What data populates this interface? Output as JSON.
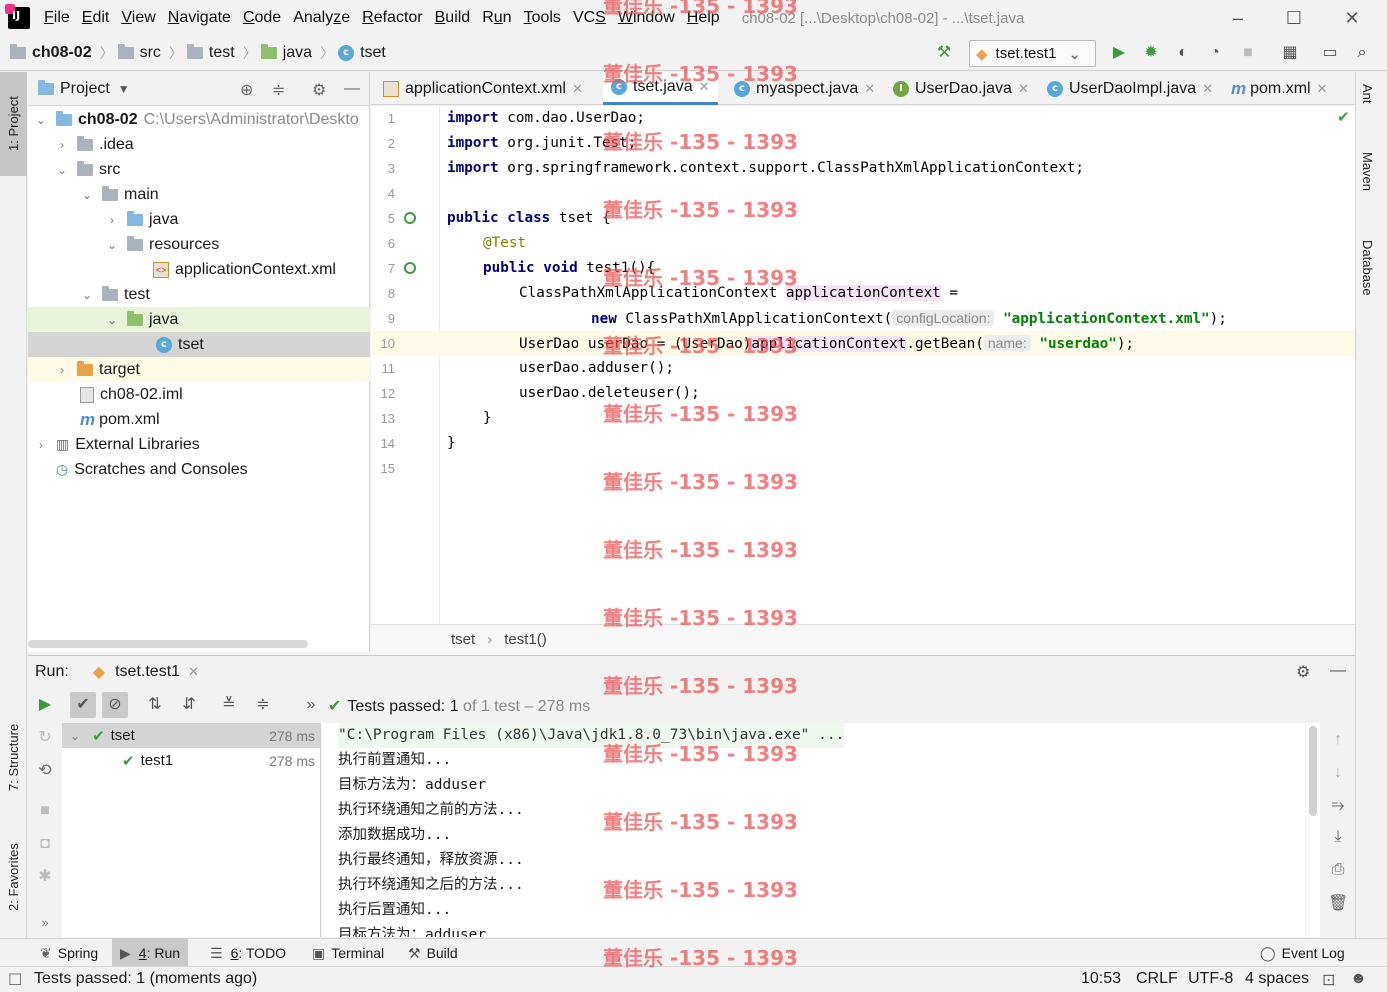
{
  "menu": {
    "items": [
      "File",
      "Edit",
      "View",
      "Navigate",
      "Code",
      "Analyze",
      "Refactor",
      "Build",
      "Run",
      "Tools",
      "VCS",
      "Window",
      "Help"
    ],
    "mnemonics": [
      "F",
      "E",
      "V",
      "N",
      "C",
      "z",
      "R",
      "B",
      "u",
      "T",
      "S",
      "W",
      "H"
    ],
    "window_title": "ch08-02 [...\\Desktop\\ch08-02] - ...\\tset.java"
  },
  "navbar": {
    "crumbs": [
      "ch08-02",
      "src",
      "test",
      "java",
      "tset"
    ],
    "run_config": "tset.test1"
  },
  "left_stripe": {
    "project": "1: Project",
    "structure": "7: Structure",
    "favorites": "2: Favorites"
  },
  "right_stripe": {
    "ant": "Ant",
    "maven": "Maven",
    "database": "Database"
  },
  "project": {
    "title": "Project",
    "root_name": "ch08-02",
    "root_path": "C:\\Users\\Administrator\\Deskto",
    "nodes": [
      ".idea",
      "src",
      "main",
      "java",
      "resources",
      "applicationContext.xml",
      "test",
      "java",
      "tset",
      "target",
      "ch08-02.iml",
      "pom.xml",
      "External Libraries",
      "Scratches and Consoles"
    ]
  },
  "editor": {
    "tabs": [
      "applicationContext.xml",
      "tset.java",
      "myaspect.java",
      "UserDao.java",
      "UserDaoImpl.java",
      "pom.xml"
    ],
    "active_tab": "tset.java",
    "line_numbers": [
      "1",
      "2",
      "3",
      "4",
      "5",
      "6",
      "7",
      "8",
      "9",
      "10",
      "11",
      "12",
      "13",
      "14",
      "15"
    ],
    "code": {
      "l1_kw": "import",
      "l1_rest": " com.dao.UserDao;",
      "l2_kw": "import",
      "l2_rest": " org.junit.Test;",
      "l3_kw": "import",
      "l3_rest": " org.springframework.context.support.ClassPathXmlApplicationContext;",
      "l5_kw": "public class",
      "l5_rest": " tset {",
      "l6_ann": "@Test",
      "l7_kw": "public void",
      "l7_rest": " test1(){",
      "l8_a": "ClassPathXmlApplicationContext ",
      "l8_var": "applicationContext",
      "l8_b": " =",
      "l9_kw": "new",
      "l9_a": " ClassPathXmlApplicationContext(",
      "l9_hint": "configLocation:",
      "l9_str": "\"applicationContext.xml\"",
      "l9_b": ");",
      "l10_a": "UserDao userDao = (UserDao)",
      "l10_var": "applicationContext",
      "l10_b": ".getBean(",
      "l10_hint": "name:",
      "l10_str": "\"userdao\"",
      "l10_c": ");",
      "l11": "userDao.adduser();",
      "l12": "userDao.deleteuser();",
      "l13": "}",
      "l14": "}"
    },
    "breadcrumb": [
      "tset",
      "test1()"
    ]
  },
  "run": {
    "label": "Run:",
    "tab": "tset.test1",
    "status_prefix": "Tests passed:",
    "status_count": "1",
    "status_suffix": "of 1 test – 278 ms",
    "tree": [
      {
        "name": "tset",
        "time": "278 ms"
      },
      {
        "name": "test1",
        "time": "278 ms"
      }
    ],
    "console": [
      "\"C:\\Program Files (x86)\\Java\\jdk1.8.0_73\\bin\\java.exe\" ...",
      "执行前置通知...",
      "目标方法为：adduser",
      "执行环绕通知之前的方法...",
      "添加数据成功...",
      "执行最终通知，释放资源...",
      "执行环绕通知之后的方法...",
      "执行后置通知...",
      "目标方法为：adduser"
    ]
  },
  "toolwindows": {
    "spring": "Spring",
    "run_num": "4",
    "run": ": Run",
    "todo_num": "6",
    "todo": ": TODO",
    "terminal": "Terminal",
    "build": "Build",
    "event_log": "Event Log"
  },
  "status": {
    "message": "Tests passed: 1 (moments ago)",
    "position": "10:53",
    "line_sep": "CRLF",
    "encoding": "UTF-8",
    "indent": "4 spaces"
  },
  "watermark": "董佳乐 -135 - 1393"
}
